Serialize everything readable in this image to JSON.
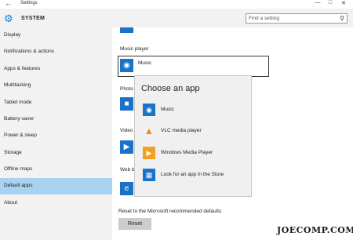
{
  "window": {
    "title": "Settings"
  },
  "header": {
    "section": "SYSTEM",
    "search_placeholder": "Find a setting"
  },
  "sidebar": {
    "items": [
      {
        "label": "Display"
      },
      {
        "label": "Notifications & actions"
      },
      {
        "label": "Apps & features"
      },
      {
        "label": "Multitasking"
      },
      {
        "label": "Tablet mode"
      },
      {
        "label": "Battery saver"
      },
      {
        "label": "Power & sleep"
      },
      {
        "label": "Storage"
      },
      {
        "label": "Offline maps"
      },
      {
        "label": "Default apps",
        "active": true
      },
      {
        "label": "About"
      }
    ]
  },
  "main": {
    "music_player_label": "Music player",
    "music_player_app": "Music",
    "photo_label_partial": "Photo",
    "video_label_partial": "Video",
    "web_label_partial": "Web b",
    "reset_label": "Reset to the Microsoft recommended defaults",
    "reset_button": "Reset"
  },
  "popup": {
    "title": "Choose an app",
    "items": [
      {
        "label": "Music",
        "icon": "music-icon"
      },
      {
        "label": "VLC media player",
        "icon": "vlc-cone-icon"
      },
      {
        "label": "Windows Media Player",
        "icon": "media-player-icon"
      },
      {
        "label": "Look for an app in the Store",
        "icon": "store-icon"
      }
    ]
  },
  "watermark": "JOECOMP.COM",
  "colors": {
    "accent": "#1a73c9",
    "active_nav": "#a9d2f0"
  }
}
